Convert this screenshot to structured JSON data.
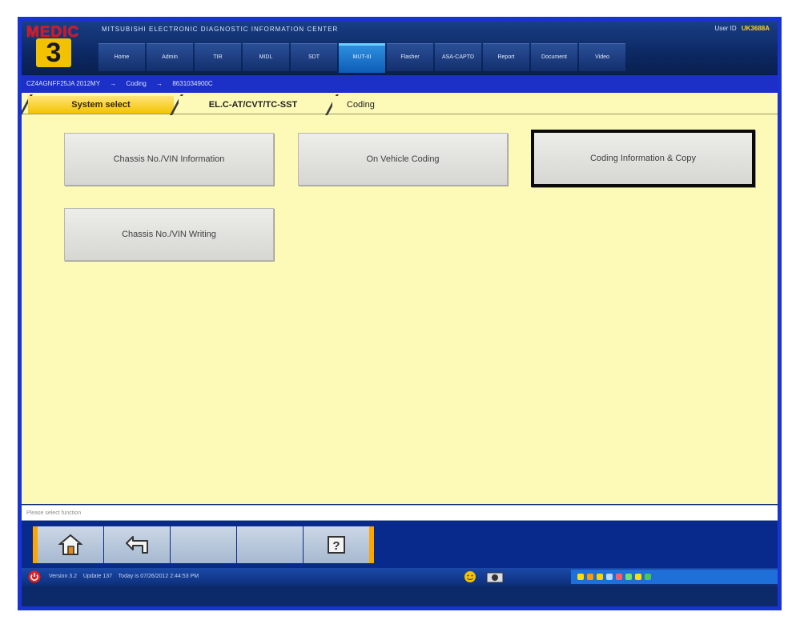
{
  "header": {
    "logo_text": "MEDIC",
    "logo_number": "3",
    "center_title": "MITSUBISHI ELECTRONIC DIAGNOSTIC INFORMATION CENTER",
    "user_id_label": "User ID",
    "user_id": "UK3688A",
    "menu": [
      {
        "label": "Home"
      },
      {
        "label": "Admin"
      },
      {
        "label": "TIR"
      },
      {
        "label": "MIDL"
      },
      {
        "label": "SDT"
      },
      {
        "label": "MUT-III"
      },
      {
        "label": "Flasher"
      },
      {
        "label": "ASA-CAPTD"
      },
      {
        "label": "Report"
      },
      {
        "label": "Document"
      },
      {
        "label": "Video"
      }
    ],
    "active_menu": "MUT-III"
  },
  "breadcrumb": {
    "vin": "CZ4AGNFF25JA 2012MY",
    "sep1": "→",
    "section": "Coding",
    "sep2": "→",
    "part": "8631034900C"
  },
  "tabs": {
    "t1": "System select",
    "t2": "EL.C-AT/CVT/TC-SST",
    "t3": "Coding"
  },
  "buttons": {
    "chassis_info": "Chassis No./VIN Information",
    "on_vehicle_coding": "On Vehicle Coding",
    "coding_info_copy": "Coding Information & Copy",
    "chassis_writing": "Chassis No./VIN Writing"
  },
  "status_text": "Please select function",
  "taskbar": {
    "version": "Version 3.2",
    "update": "Update 137",
    "today": "Today is 07/26/2012 2:44:53 PM"
  },
  "colors": {
    "frame": "#1a33d6",
    "content_bg": "#fcfab6",
    "tab_active": "#f2c400",
    "accent_orange": "#ffa500",
    "toolbar_bg": "#082a8c",
    "logo_red": "#e0101b"
  },
  "icons": {
    "toolbar": [
      "home-icon",
      "back-icon",
      "blank",
      "blank",
      "help-icon"
    ]
  }
}
